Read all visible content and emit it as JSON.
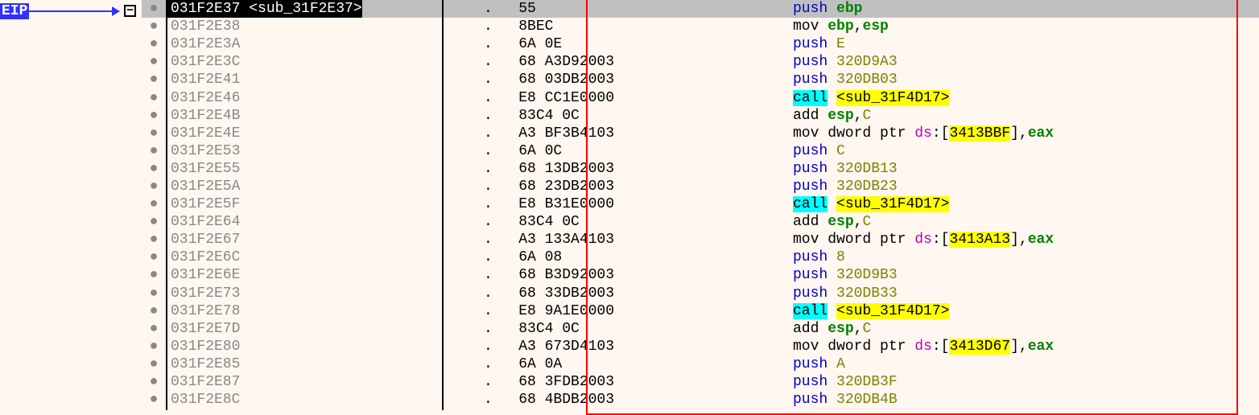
{
  "eip_label": "EIP",
  "fold_symbol": "−",
  "rows": [
    {
      "bp": "●",
      "addr": "031F2E37",
      "label": " <sub_31F2E37>",
      "current": true,
      "bytes": "55",
      "disasm": [
        [
          "mnemonic",
          "push"
        ],
        [
          "sp",
          " "
        ],
        [
          "reg",
          "ebp"
        ]
      ]
    },
    {
      "bp": "●",
      "addr": "031F2E38",
      "bytes": "8BEC",
      "disasm": [
        [
          "plain",
          "mov "
        ],
        [
          "reg",
          "ebp"
        ],
        [
          "comma",
          ","
        ],
        [
          "reg",
          "esp"
        ]
      ]
    },
    {
      "bp": "●",
      "addr": "031F2E3A",
      "bytes": "6A 0E",
      "disasm": [
        [
          "mnemonic",
          "push"
        ],
        [
          "sp",
          " "
        ],
        [
          "imm",
          "E"
        ]
      ]
    },
    {
      "bp": "●",
      "addr": "031F2E3C",
      "bytes": "68 A3D92003",
      "disasm": [
        [
          "mnemonic",
          "push"
        ],
        [
          "sp",
          " "
        ],
        [
          "imm",
          "320D9A3"
        ]
      ]
    },
    {
      "bp": "●",
      "addr": "031F2E41",
      "bytes": "68 03DB2003",
      "disasm": [
        [
          "mnemonic",
          "push"
        ],
        [
          "sp",
          " "
        ],
        [
          "imm",
          "320DB03"
        ]
      ]
    },
    {
      "bp": "●",
      "addr": "031F2E46",
      "bytes": "E8 CC1E0000",
      "disasm": [
        [
          "call",
          "call"
        ],
        [
          "sp",
          " "
        ],
        [
          "hly",
          "<sub_31F4D17>"
        ]
      ]
    },
    {
      "bp": "●",
      "addr": "031F2E4B",
      "bytes": "83C4 0C",
      "disasm": [
        [
          "plain",
          "add "
        ],
        [
          "reg",
          "esp"
        ],
        [
          "comma",
          ","
        ],
        [
          "imm",
          "C"
        ]
      ]
    },
    {
      "bp": "●",
      "addr": "031F2E4E",
      "bytes": "A3 BF3B4103",
      "disasm": [
        [
          "plain",
          "mov dword ptr "
        ],
        [
          "segptr",
          "ds"
        ],
        [
          "brack",
          ":["
        ],
        [
          "hly",
          "3413BBF"
        ],
        [
          "brack",
          "]"
        ],
        [
          "comma",
          ","
        ],
        [
          "reg",
          "eax"
        ]
      ]
    },
    {
      "bp": "●",
      "addr": "031F2E53",
      "bytes": "6A 0C",
      "disasm": [
        [
          "mnemonic",
          "push"
        ],
        [
          "sp",
          " "
        ],
        [
          "imm",
          "C"
        ]
      ]
    },
    {
      "bp": "●",
      "addr": "031F2E55",
      "bytes": "68 13DB2003",
      "disasm": [
        [
          "mnemonic",
          "push"
        ],
        [
          "sp",
          " "
        ],
        [
          "imm",
          "320DB13"
        ]
      ]
    },
    {
      "bp": "●",
      "addr": "031F2E5A",
      "bytes": "68 23DB2003",
      "disasm": [
        [
          "mnemonic",
          "push"
        ],
        [
          "sp",
          " "
        ],
        [
          "imm",
          "320DB23"
        ]
      ]
    },
    {
      "bp": "●",
      "addr": "031F2E5F",
      "bytes": "E8 B31E0000",
      "disasm": [
        [
          "call",
          "call"
        ],
        [
          "sp",
          " "
        ],
        [
          "hly",
          "<sub_31F4D17>"
        ]
      ]
    },
    {
      "bp": "●",
      "addr": "031F2E64",
      "bytes": "83C4 0C",
      "disasm": [
        [
          "plain",
          "add "
        ],
        [
          "reg",
          "esp"
        ],
        [
          "comma",
          ","
        ],
        [
          "imm",
          "C"
        ]
      ]
    },
    {
      "bp": "●",
      "addr": "031F2E67",
      "bytes": "A3 133A4103",
      "disasm": [
        [
          "plain",
          "mov dword ptr "
        ],
        [
          "segptr",
          "ds"
        ],
        [
          "brack",
          ":["
        ],
        [
          "hly",
          "3413A13"
        ],
        [
          "brack",
          "]"
        ],
        [
          "comma",
          ","
        ],
        [
          "reg",
          "eax"
        ]
      ]
    },
    {
      "bp": "●",
      "addr": "031F2E6C",
      "bytes": "6A 08",
      "disasm": [
        [
          "mnemonic",
          "push"
        ],
        [
          "sp",
          " "
        ],
        [
          "imm",
          "8"
        ]
      ]
    },
    {
      "bp": "●",
      "addr": "031F2E6E",
      "bytes": "68 B3D92003",
      "disasm": [
        [
          "mnemonic",
          "push"
        ],
        [
          "sp",
          " "
        ],
        [
          "imm",
          "320D9B3"
        ]
      ]
    },
    {
      "bp": "●",
      "addr": "031F2E73",
      "bytes": "68 33DB2003",
      "disasm": [
        [
          "mnemonic",
          "push"
        ],
        [
          "sp",
          " "
        ],
        [
          "imm",
          "320DB33"
        ]
      ]
    },
    {
      "bp": "●",
      "addr": "031F2E78",
      "bytes": "E8 9A1E0000",
      "disasm": [
        [
          "call",
          "call"
        ],
        [
          "sp",
          " "
        ],
        [
          "hly",
          "<sub_31F4D17>"
        ]
      ]
    },
    {
      "bp": "●",
      "addr": "031F2E7D",
      "bytes": "83C4 0C",
      "disasm": [
        [
          "plain",
          "add "
        ],
        [
          "reg",
          "esp"
        ],
        [
          "comma",
          ","
        ],
        [
          "imm",
          "C"
        ]
      ]
    },
    {
      "bp": "●",
      "addr": "031F2E80",
      "bytes": "A3 673D4103",
      "disasm": [
        [
          "plain",
          "mov dword ptr "
        ],
        [
          "segptr",
          "ds"
        ],
        [
          "brack",
          ":["
        ],
        [
          "hly",
          "3413D67"
        ],
        [
          "brack",
          "]"
        ],
        [
          "comma",
          ","
        ],
        [
          "reg",
          "eax"
        ]
      ]
    },
    {
      "bp": "●",
      "addr": "031F2E85",
      "bytes": "6A 0A",
      "disasm": [
        [
          "mnemonic",
          "push"
        ],
        [
          "sp",
          " "
        ],
        [
          "imm",
          "A"
        ]
      ]
    },
    {
      "bp": "●",
      "addr": "031F2E87",
      "bytes": "68 3FDB2003",
      "disasm": [
        [
          "mnemonic",
          "push"
        ],
        [
          "sp",
          " "
        ],
        [
          "imm",
          "320DB3F"
        ]
      ]
    },
    {
      "bp": "●",
      "addr": "031F2E8C",
      "bytes": "68 4BDB2003",
      "disasm": [
        [
          "mnemonic",
          "push"
        ],
        [
          "sp",
          " "
        ],
        [
          "imm",
          "320DB4B"
        ]
      ]
    }
  ]
}
